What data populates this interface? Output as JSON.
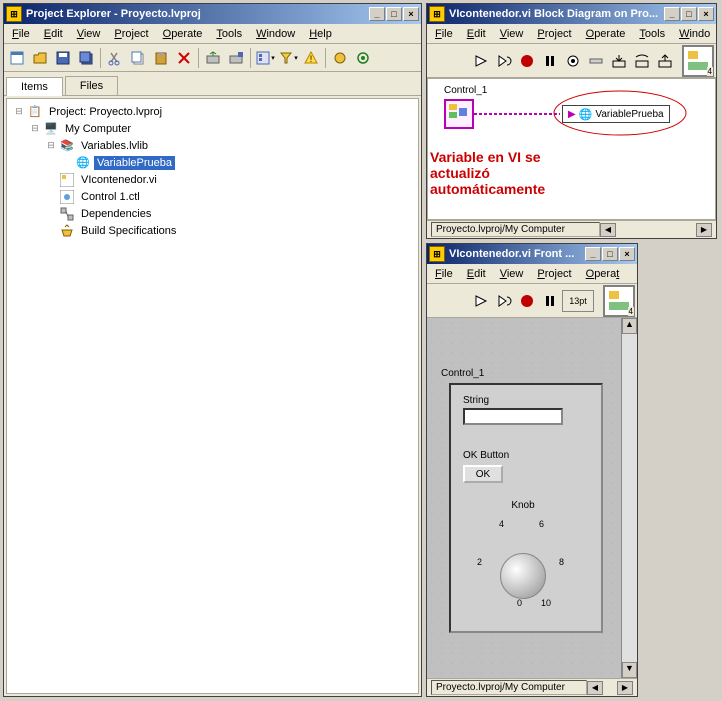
{
  "projectExplorer": {
    "title": "Project Explorer - Proyecto.lvproj",
    "menus": [
      "File",
      "Edit",
      "View",
      "Project",
      "Operate",
      "Tools",
      "Window",
      "Help"
    ],
    "tabs": {
      "items": "Items",
      "files": "Files"
    },
    "tree": {
      "project": "Project: Proyecto.lvproj",
      "myComputer": "My Computer",
      "variablesLib": "Variables.lvlib",
      "variablePrueba": "VariablePrueba",
      "vicontenedor": "VIcontenedor.vi",
      "control1": "Control 1.ctl",
      "dependencies": "Dependencies",
      "buildSpecs": "Build Specifications"
    }
  },
  "blockDiagram": {
    "title": "VIcontenedor.vi Block Diagram on Pro...",
    "menus": [
      "File",
      "Edit",
      "View",
      "Project",
      "Operate",
      "Tools",
      "Windo"
    ],
    "nodeLabel": "Control_1",
    "varName": "VariablePrueba",
    "annotation": "Variable en VI se\nactualizó\nautomáticamente",
    "statusPath": "Proyecto.lvproj/My Computer"
  },
  "frontPanel": {
    "title": "VIcontenedor.vi Front ...",
    "menus": [
      "File",
      "Edit",
      "View",
      "Project",
      "Operat"
    ],
    "fontSize": "13pt",
    "clusterLabel": "Control_1",
    "stringLabel": "String",
    "stringValue": "",
    "okLabel": "OK Button",
    "okBtn": "OK",
    "knobLabel": "Knob",
    "knobTicks": {
      "t0": "0",
      "t2": "2",
      "t4": "4",
      "t6": "6",
      "t8": "8",
      "t10": "10"
    },
    "statusPath": "Proyecto.lvproj/My Computer"
  }
}
